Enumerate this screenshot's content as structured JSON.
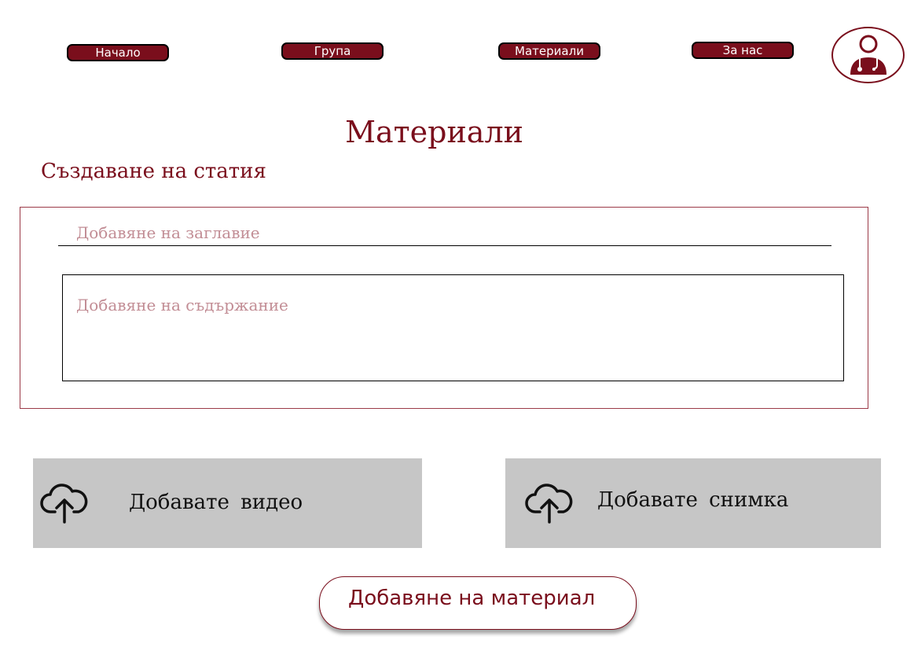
{
  "nav": {
    "items": [
      {
        "label": "Начало"
      },
      {
        "label": "Група"
      },
      {
        "label": "Материали"
      },
      {
        "label": "За нас"
      }
    ],
    "profile_icon": "doctor-user-icon"
  },
  "page": {
    "title": "Материали",
    "section_title": "Създаване на статия"
  },
  "form": {
    "title_placeholder": "Добавяне на заглавие",
    "content_placeholder": "Добавяне на съдържание"
  },
  "uploads": {
    "video_label": "Добавате видео",
    "image_label": "Добавате снимка",
    "icon": "cloud-upload-icon"
  },
  "actions": {
    "submit_label": "Добавяне на материал"
  },
  "colors": {
    "brand": "#7a0e1c",
    "upload_bg": "#c6c6c6",
    "placeholder": "#c28d95"
  }
}
